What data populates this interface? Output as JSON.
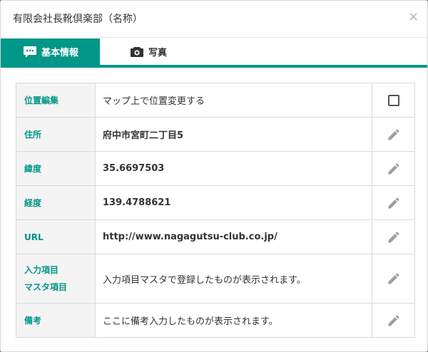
{
  "modal": {
    "title": "有限会社長靴倶楽部（名称）",
    "close_glyph": "×"
  },
  "tabs": [
    {
      "label": "基本情報",
      "icon": "comment-icon",
      "active": true
    },
    {
      "label": "写真",
      "icon": "camera-icon",
      "active": false
    }
  ],
  "rows": [
    {
      "label": "位置編集",
      "value": "マップ上で位置変更する",
      "action": "checkbox"
    },
    {
      "label": "住所",
      "value": "府中市宮町二丁目5",
      "action": "edit"
    },
    {
      "label": "緯度",
      "value": "35.6697503",
      "action": "edit"
    },
    {
      "label": "経度",
      "value": "139.4788621",
      "action": "edit"
    },
    {
      "label": "URL",
      "value": "http://www.nagagutsu-club.co.jp/",
      "action": "edit"
    },
    {
      "label_line1": "入力項目",
      "label_line2": "マスタ項目",
      "value": "入力項目マスタで登録したものが表示されます。",
      "action": "edit"
    },
    {
      "label": "備考",
      "value": "ここに備考入力したものが表示されます。",
      "action": "edit"
    }
  ],
  "colors": {
    "accent": "#009688",
    "label_bg": "#f4f4f4",
    "icon_gray": "#9e9e9e"
  }
}
